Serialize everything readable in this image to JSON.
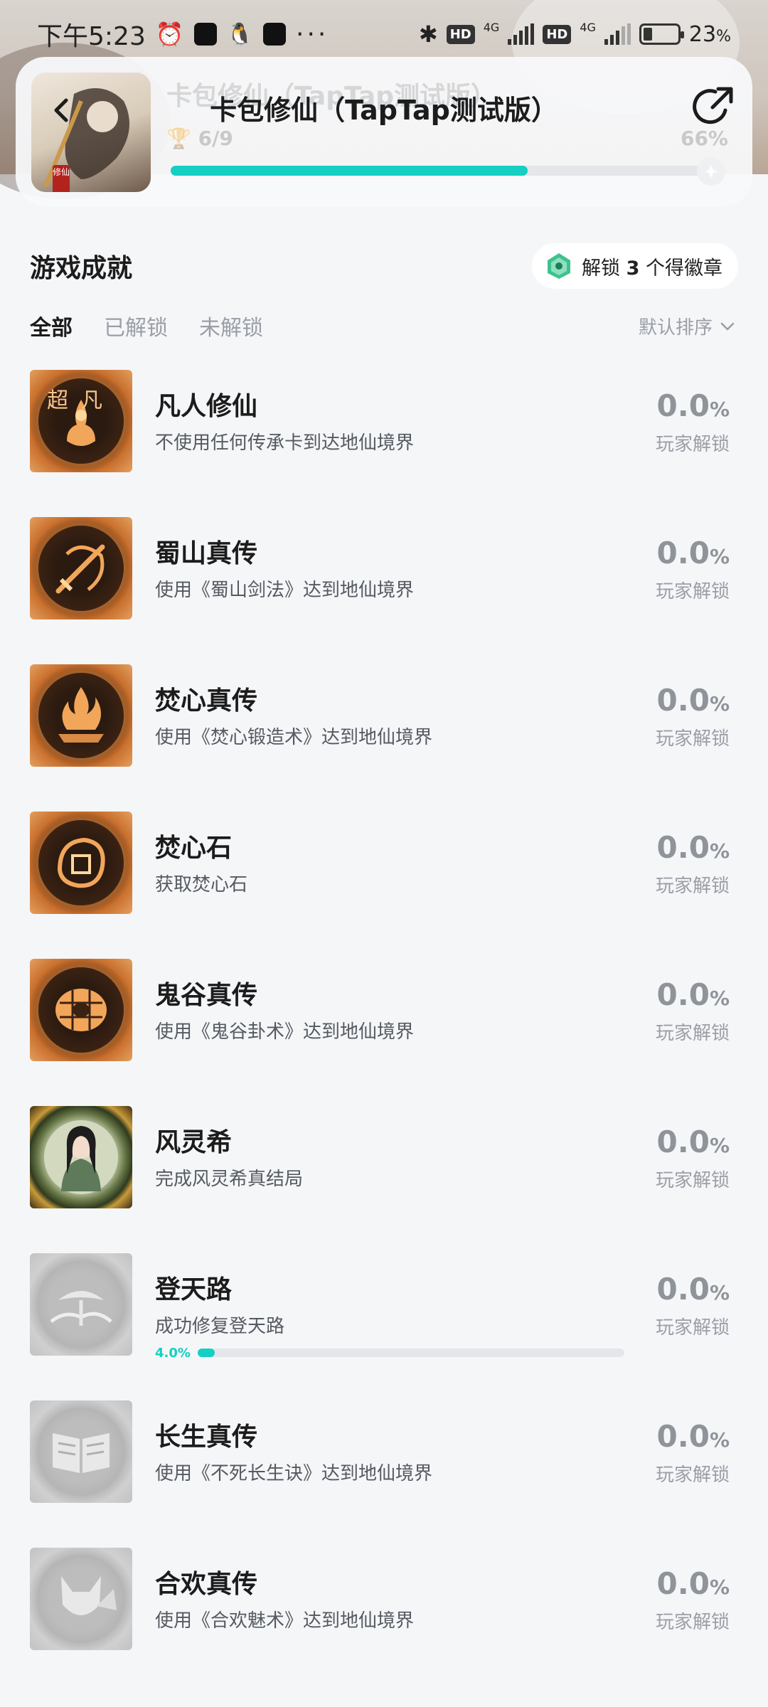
{
  "status_bar": {
    "time": "下午5:23",
    "network_1": "4G",
    "network_2": "4G",
    "hd_1": "HD",
    "hd_2": "HD",
    "battery": "23",
    "battery_unit": "%",
    "battery_level": 0.23
  },
  "header": {
    "title": "卡包修仙（TapTap测试版）",
    "ghost_title": "卡包修仙（TapTap测试版）",
    "achievement_count": "6/9",
    "progress_label": "66%",
    "progress": 0.66,
    "thumb_tag": "修仙"
  },
  "section": {
    "title": "游戏成就",
    "unlock_prefix": "解锁 ",
    "unlock_count": "3",
    "unlock_suffix": " 个得徽章",
    "tabs": [
      "全部",
      "已解锁",
      "未解锁"
    ],
    "sort_label": "默认排序"
  },
  "colors": {
    "accent": "#14cfc2",
    "text_primary": "#1c1c1c",
    "text_muted": "#9a9ea6"
  },
  "achievements": [
    {
      "title": "凡人修仙",
      "desc": "不使用任何传承卡到达地仙境界",
      "pct": "0.0",
      "pct_unit": "%",
      "pct_label": "玩家解锁",
      "icon": "immortal-fire-icon",
      "style": "gold",
      "badge_text": "超凡"
    },
    {
      "title": "蜀山真传",
      "desc": "使用《蜀山剑法》达到地仙境界",
      "pct": "0.0",
      "pct_unit": "%",
      "pct_label": "玩家解锁",
      "icon": "sword-icon",
      "style": "gold"
    },
    {
      "title": "焚心真传",
      "desc": "使用《焚心锻造术》达到地仙境界",
      "pct": "0.0",
      "pct_unit": "%",
      "pct_label": "玩家解锁",
      "icon": "flame-forge-icon",
      "style": "gold"
    },
    {
      "title": "焚心石",
      "desc": "获取焚心石",
      "pct": "0.0",
      "pct_unit": "%",
      "pct_label": "玩家解锁",
      "icon": "flame-stone-icon",
      "style": "gold"
    },
    {
      "title": "鬼谷真传",
      "desc": "使用《鬼谷卦术》达到地仙境界",
      "pct": "0.0",
      "pct_unit": "%",
      "pct_label": "玩家解锁",
      "icon": "turtle-shell-icon",
      "style": "gold"
    },
    {
      "title": "风灵希",
      "desc": "完成风灵希真结局",
      "pct": "0.0",
      "pct_unit": "%",
      "pct_label": "玩家解锁",
      "icon": "character-portrait-icon",
      "style": "portrait"
    },
    {
      "title": "登天路",
      "desc": "成功修复登天路",
      "pct": "0.0",
      "pct_unit": "%",
      "pct_label": "玩家解锁",
      "icon": "mountain-pine-icon",
      "style": "gray",
      "progress_label": "4.0%",
      "progress": 0.04
    },
    {
      "title": "长生真传",
      "desc": "使用《不死长生诀》达到地仙境界",
      "pct": "0.0",
      "pct_unit": "%",
      "pct_label": "玩家解锁",
      "icon": "open-book-icon",
      "style": "gray"
    },
    {
      "title": "合欢真传",
      "desc": "使用《合欢魅术》达到地仙境界",
      "pct": "0.0",
      "pct_unit": "%",
      "pct_label": "玩家解锁",
      "icon": "fox-fan-icon",
      "style": "gray"
    }
  ]
}
